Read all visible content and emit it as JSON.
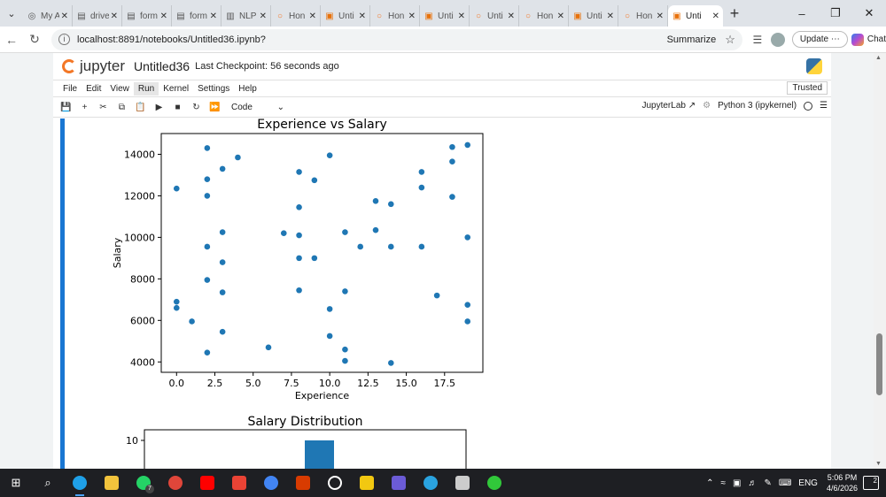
{
  "browser": {
    "tabs": [
      {
        "icon": "globe-icon",
        "title": "My A"
      },
      {
        "icon": "doc-icon",
        "title": "drive"
      },
      {
        "icon": "doc-icon",
        "title": "form"
      },
      {
        "icon": "doc-icon",
        "title": "form"
      },
      {
        "icon": "book-icon",
        "title": "NLP"
      },
      {
        "icon": "jupyter-icon",
        "title": "Hon"
      },
      {
        "icon": "notebook-icon",
        "title": "Unti"
      },
      {
        "icon": "jupyter-icon",
        "title": "Hon"
      },
      {
        "icon": "notebook-icon",
        "title": "Unti"
      },
      {
        "icon": "jupyter-icon",
        "title": "Unti"
      },
      {
        "icon": "jupyter-icon",
        "title": "Hon"
      },
      {
        "icon": "notebook-icon",
        "title": "Unti"
      },
      {
        "icon": "jupyter-icon",
        "title": "Hon"
      },
      {
        "icon": "notebook-icon",
        "title": "Unti",
        "active": true
      }
    ],
    "url": "localhost:8891/notebooks/Untitled36.ipynb?",
    "summarize_label": "Summarize",
    "update_label": "Update",
    "chat_label": "Chat"
  },
  "jupyter": {
    "logo_text": "jupyter",
    "notebook_name": "Untitled36",
    "checkpoint": "Last Checkpoint: 56 seconds ago",
    "menu": [
      "File",
      "Edit",
      "View",
      "Run",
      "Kernel",
      "Settings",
      "Help"
    ],
    "menu_selected": "Run",
    "trusted_label": "Trusted",
    "cell_type": "Code",
    "jupyterlab_label": "JupyterLab",
    "kernel_label": "Python 3 (ipykernel)"
  },
  "chart_data": [
    {
      "type": "scatter",
      "title": "Experience vs Salary",
      "xlabel": "Experience",
      "ylabel": "Salary",
      "xlim": [
        -1,
        20
      ],
      "ylim": [
        3500,
        15000
      ],
      "xticks": [
        0.0,
        2.5,
        5.0,
        7.5,
        10.0,
        12.5,
        15.0,
        17.5
      ],
      "xtick_labels": [
        "0.0",
        "2.5",
        "5.0",
        "7.5",
        "10.0",
        "12.5",
        "15.0",
        "17.5"
      ],
      "yticks": [
        4000,
        6000,
        8000,
        10000,
        12000,
        14000
      ],
      "ytick_labels": [
        "4000",
        "6000",
        "8000",
        "10000",
        "12000",
        "14000"
      ],
      "color": "#1f77b4",
      "x": [
        0,
        0,
        0,
        1,
        2,
        2,
        2,
        2,
        2,
        2,
        3,
        3,
        3,
        3,
        3,
        4,
        6,
        7,
        8,
        8,
        8,
        8,
        8,
        9,
        9,
        10,
        10,
        10,
        11,
        11,
        11,
        11,
        12,
        13,
        13,
        14,
        14,
        14,
        16,
        16,
        16,
        17,
        18,
        18,
        18,
        19,
        19,
        19,
        19
      ],
      "y": [
        12350,
        6900,
        6600,
        5950,
        14300,
        12800,
        12000,
        9550,
        7950,
        4450,
        13300,
        10250,
        8800,
        7350,
        5450,
        13850,
        4700,
        10200,
        13150,
        11450,
        10100,
        9000,
        7450,
        12750,
        9000,
        13950,
        6550,
        5250,
        10250,
        7400,
        4600,
        4050,
        9550,
        11750,
        10350,
        11600,
        9550,
        3950,
        13150,
        12400,
        9550,
        7200,
        14350,
        13650,
        11950,
        14450,
        10000,
        6750,
        5950
      ]
    },
    {
      "type": "bar",
      "title": "Salary Distribution",
      "yticks": [
        10
      ],
      "ytick_labels": [
        "10"
      ],
      "color": "#1f77b4",
      "values": [
        10
      ]
    }
  ],
  "taskbar": {
    "apps": [
      "start-icon",
      "search-icon",
      "edge-icon",
      "file-explorer-icon",
      "whatsapp-icon",
      "chrome-icon",
      "youtube-icon",
      "gmail-icon",
      "google-icon",
      "office-icon",
      "chatgpt-icon",
      "power-bi-icon",
      "visual-studio-icon",
      "telegram-icon",
      "settings-icon",
      "refresh-app-icon"
    ],
    "whatsapp_badge": "7",
    "lang": "ENG",
    "time": "5:06 PM",
    "date": "4/6/2026",
    "notifications": "2"
  }
}
